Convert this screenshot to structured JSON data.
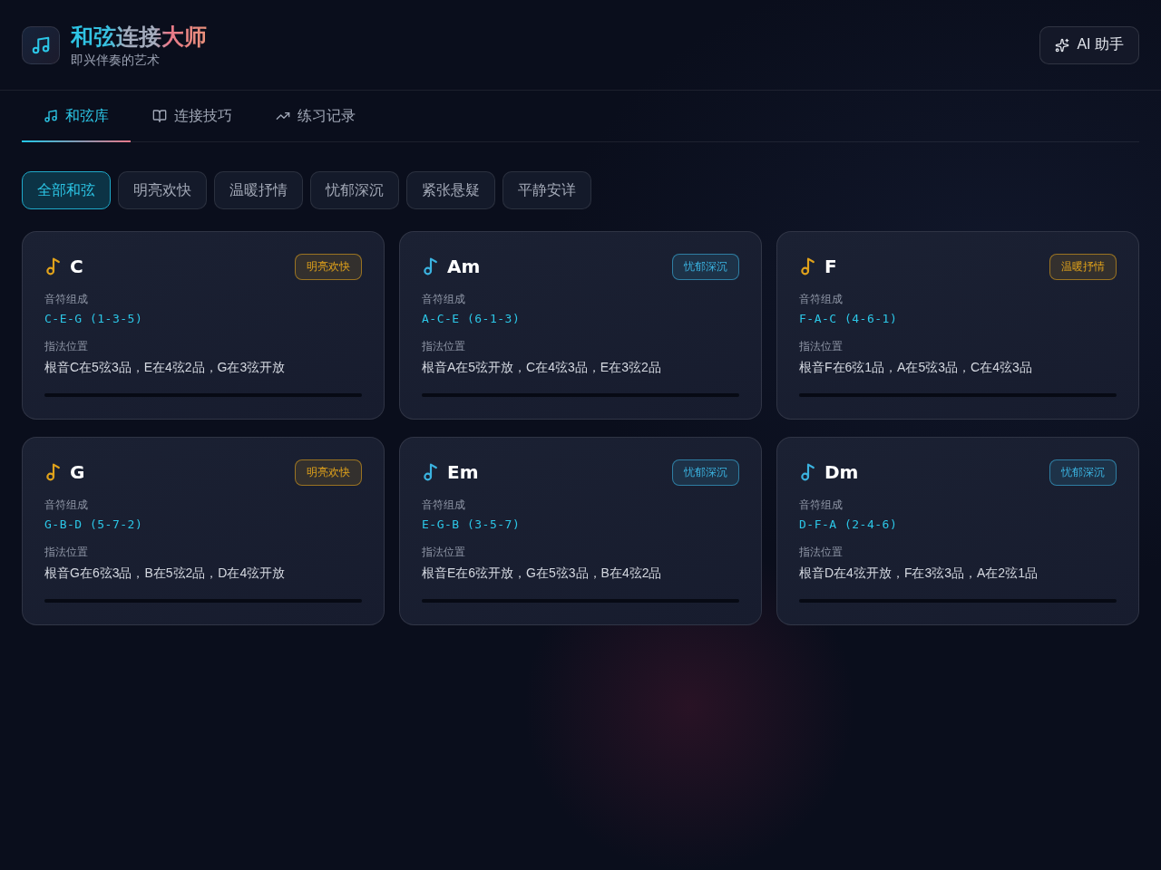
{
  "header": {
    "title": "和弦连接大师",
    "subtitle": "即兴伴奏的艺术",
    "assistant_button": {
      "label": "AI 助手"
    }
  },
  "tabs": [
    {
      "label": "和弦库",
      "selected": true
    },
    {
      "label": "连接技巧",
      "selected": false
    },
    {
      "label": "练习记录",
      "selected": false
    }
  ],
  "filters": [
    {
      "label": "全部和弦",
      "selected": true
    },
    {
      "label": "明亮欢快",
      "selected": false
    },
    {
      "label": "温暖抒情",
      "selected": false
    },
    {
      "label": "忧郁深沉",
      "selected": false
    },
    {
      "label": "紧张悬疑",
      "selected": false
    },
    {
      "label": "平静安详",
      "selected": false
    }
  ],
  "chords": [
    {
      "name": "C",
      "tag": "明亮欢快",
      "color": "#e0a21b",
      "notes_label": "音符组成",
      "notes": "C-E-G (1-3-5)",
      "fingering_label": "指法位置",
      "fingering": "根音C在5弦3品，E在4弦2品，G在3弦开放"
    },
    {
      "name": "Am",
      "tag": "忧郁深沉",
      "color": "#3bb3e0",
      "notes_label": "音符组成",
      "notes": "A-C-E (6-1-3)",
      "fingering_label": "指法位置",
      "fingering": "根音A在5弦开放，C在4弦3品，E在3弦2品"
    },
    {
      "name": "F",
      "tag": "温暖抒情",
      "color": "#e0a21b",
      "notes_label": "音符组成",
      "notes": "F-A-C (4-6-1)",
      "fingering_label": "指法位置",
      "fingering": "根音F在6弦1品，A在5弦3品，C在4弦3品"
    },
    {
      "name": "G",
      "tag": "明亮欢快",
      "color": "#e0a21b",
      "notes_label": "音符组成",
      "notes": "G-B-D (5-7-2)",
      "fingering_label": "指法位置",
      "fingering": "根音G在6弦3品，B在5弦2品，D在4弦开放"
    },
    {
      "name": "Em",
      "tag": "忧郁深沉",
      "color": "#3bb3e0",
      "notes_label": "音符组成",
      "notes": "E-G-B (3-5-7)",
      "fingering_label": "指法位置",
      "fingering": "根音E在6弦开放，G在5弦3品，B在4弦2品"
    },
    {
      "name": "Dm",
      "tag": "忧郁深沉",
      "color": "#3bb3e0",
      "notes_label": "音符组成",
      "notes": "D-F-A (2-4-6)",
      "fingering_label": "指法位置",
      "fingering": "根音D在4弦开放，F在3弦3品，A在2弦1品"
    }
  ]
}
